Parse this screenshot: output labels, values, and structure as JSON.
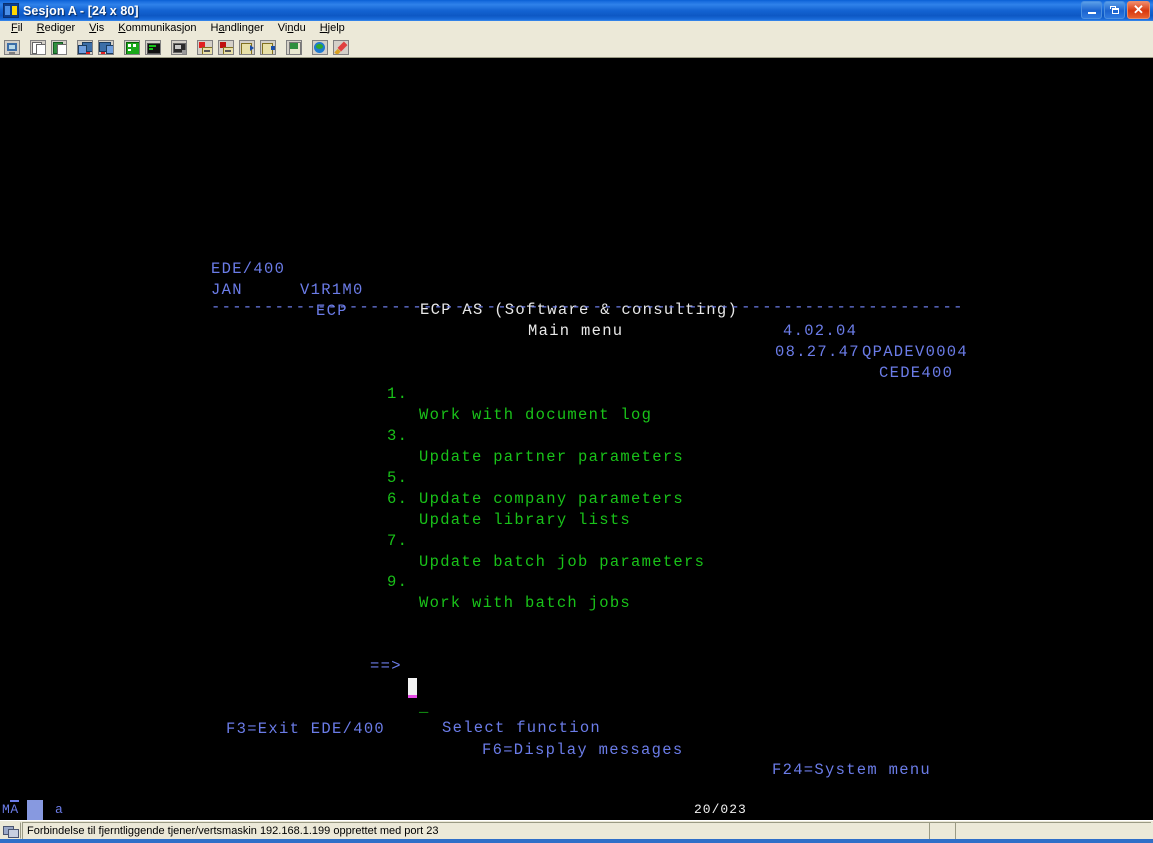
{
  "window": {
    "title": "Sesjon A - [24 x 80]",
    "icon": "session-icon",
    "buttons": {
      "minimize": "minimize-button",
      "restore": "restore-button",
      "close": "close-button"
    }
  },
  "menubar": {
    "items": [
      {
        "label": "Fil",
        "accel": "F"
      },
      {
        "label": "Rediger",
        "accel": "R"
      },
      {
        "label": "Vis",
        "accel": "V"
      },
      {
        "label": "Kommunikasjon",
        "accel": "K"
      },
      {
        "label": "Handlinger",
        "accel": "a"
      },
      {
        "label": "Vindu",
        "accel": "n"
      },
      {
        "label": "Hjelp",
        "accel": "H"
      }
    ]
  },
  "toolbar": {
    "buttons": [
      {
        "name": "display-settings-icon"
      },
      {
        "name": "copy-icon"
      },
      {
        "name": "paste-icon"
      },
      {
        "name": "send-file-icon"
      },
      {
        "name": "receive-file-icon"
      },
      {
        "name": "keypad-icon"
      },
      {
        "name": "screen-icon"
      },
      {
        "name": "print-screen-icon"
      },
      {
        "name": "macro-record-icon"
      },
      {
        "name": "macro-stop-icon"
      },
      {
        "name": "macro-play-icon"
      },
      {
        "name": "macro-edit-icon"
      },
      {
        "name": "clipboard-icon"
      },
      {
        "name": "globe-icon"
      },
      {
        "name": "pencil-icon"
      }
    ]
  },
  "terminal": {
    "header": {
      "left_product": "EDE/400",
      "left_version": "V1R1M0",
      "company": "ECP AS (Software & consulting)",
      "release": "4.02.04",
      "device": "QPADEV0004",
      "user": "JAN",
      "library": "ECP",
      "screen_title": "Main menu",
      "time": "08.27.47",
      "program": "CEDE400",
      "separator": "-----------------------------------------------------------------------"
    },
    "menu_options": [
      {
        "number": "1.",
        "label": "Work with document log"
      },
      {
        "number": "3.",
        "label": "Update partner parameters"
      },
      {
        "number": "5.",
        "label": "Update company parameters"
      },
      {
        "number": "6.",
        "label": "Update library lists"
      },
      {
        "number": "7.",
        "label": "Update batch job parameters"
      },
      {
        "number": "9.",
        "label": "Work with batch jobs"
      }
    ],
    "prompt": {
      "arrow": "==>",
      "value": "",
      "field_marker": "_",
      "label": "Select function"
    },
    "function_keys": [
      {
        "label": "F3=Exit EDE/400"
      },
      {
        "label": "F6=Display messages"
      },
      {
        "label": "F24=System menu"
      }
    ]
  },
  "oia": {
    "system_indicator": "MA",
    "input_indicator": "a",
    "cursor_position": "20/023"
  },
  "statusbar": {
    "icon": "connection-icon",
    "message": "Forbindelse til fjerntliggende tjener/vertsmaskin 192.168.1.199 opprettet med port 23"
  },
  "colors": {
    "terminal_blue": "#6b7ce8",
    "terminal_green": "#19c219",
    "terminal_white": "#e8e8e8",
    "cursor_white": "#f2f2f2",
    "cursor_magenta": "#e84ce8",
    "title_blue": "#1463d2",
    "background": "#ece9d8"
  }
}
